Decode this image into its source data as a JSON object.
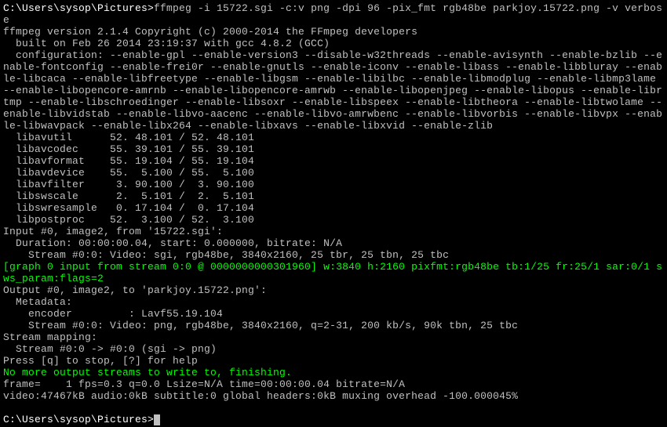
{
  "prompt1": "C:\\Users\\sysop\\Pictures>",
  "command": "ffmpeg -i 15722.sgi -c:v png -dpi 96 -pix_fmt rgb48be parkjoy.15722.png -v verbose",
  "banner": [
    "ffmpeg version 2.1.4 Copyright (c) 2000-2014 the FFmpeg developers",
    "  built on Feb 26 2014 23:19:37 with gcc 4.8.2 (GCC)",
    "  configuration: --enable-gpl --enable-version3 --disable-w32threads --enable-avisynth --enable-bzlib --enable-fontconfig --enable-frei0r --enable-gnutls --enable-iconv --enable-libass --enable-libbluray --enable-libcaca --enable-libfreetype --enable-libgsm --enable-libilbc --enable-libmodplug --enable-libmp3lame --enable-libopencore-amrnb --enable-libopencore-amrwb --enable-libopenjpeg --enable-libopus --enable-librtmp --enable-libschroedinger --enable-libsoxr --enable-libspeex --enable-libtheora --enable-libtwolame --enable-libvidstab --enable-libvo-aacenc --enable-libvo-amrwbenc --enable-libvorbis --enable-libvpx --enable-libwavpack --enable-libx264 --enable-libxavs --enable-libxvid --enable-zlib"
  ],
  "libs": [
    "  libavutil      52. 48.101 / 52. 48.101",
    "  libavcodec     55. 39.101 / 55. 39.101",
    "  libavformat    55. 19.104 / 55. 19.104",
    "  libavdevice    55.  5.100 / 55.  5.100",
    "  libavfilter     3. 90.100 /  3. 90.100",
    "  libswscale      2.  5.101 /  2.  5.101",
    "  libswresample   0. 17.104 /  0. 17.104",
    "  libpostproc    52.  3.100 / 52.  3.100"
  ],
  "input": [
    "Input #0, image2, from '15722.sgi':",
    "  Duration: 00:00:00.04, start: 0.000000, bitrate: N/A",
    "    Stream #0:0: Video: sgi, rgb48be, 3840x2160, 25 tbr, 25 tbn, 25 tbc"
  ],
  "graph": "[graph 0 input from stream 0:0 @ 0000000000301960] w:3840 h:2160 pixfmt:rgb48be tb:1/25 fr:25/1 sar:0/1 sws_param:flags=2",
  "output": [
    "Output #0, image2, to 'parkjoy.15722.png':",
    "  Metadata:",
    "    encoder         : Lavf55.19.104",
    "    Stream #0:0: Video: png, rgb48be, 3840x2160, q=2-31, 200 kb/s, 90k tbn, 25 tbc",
    "Stream mapping:",
    "  Stream #0:0 -> #0:0 (sgi -> png)",
    "Press [q] to stop, [?] for help"
  ],
  "finish": "No more output streams to write to, finishing.",
  "frame": "frame=    1 fps=0.3 q=0.0 Lsize=N/A time=00:00:00.04 bitrate=N/A    ",
  "video": "video:47467kB audio:0kB subtitle:0 global headers:0kB muxing overhead -100.000045%",
  "prompt2": "C:\\Users\\sysop\\Pictures>"
}
